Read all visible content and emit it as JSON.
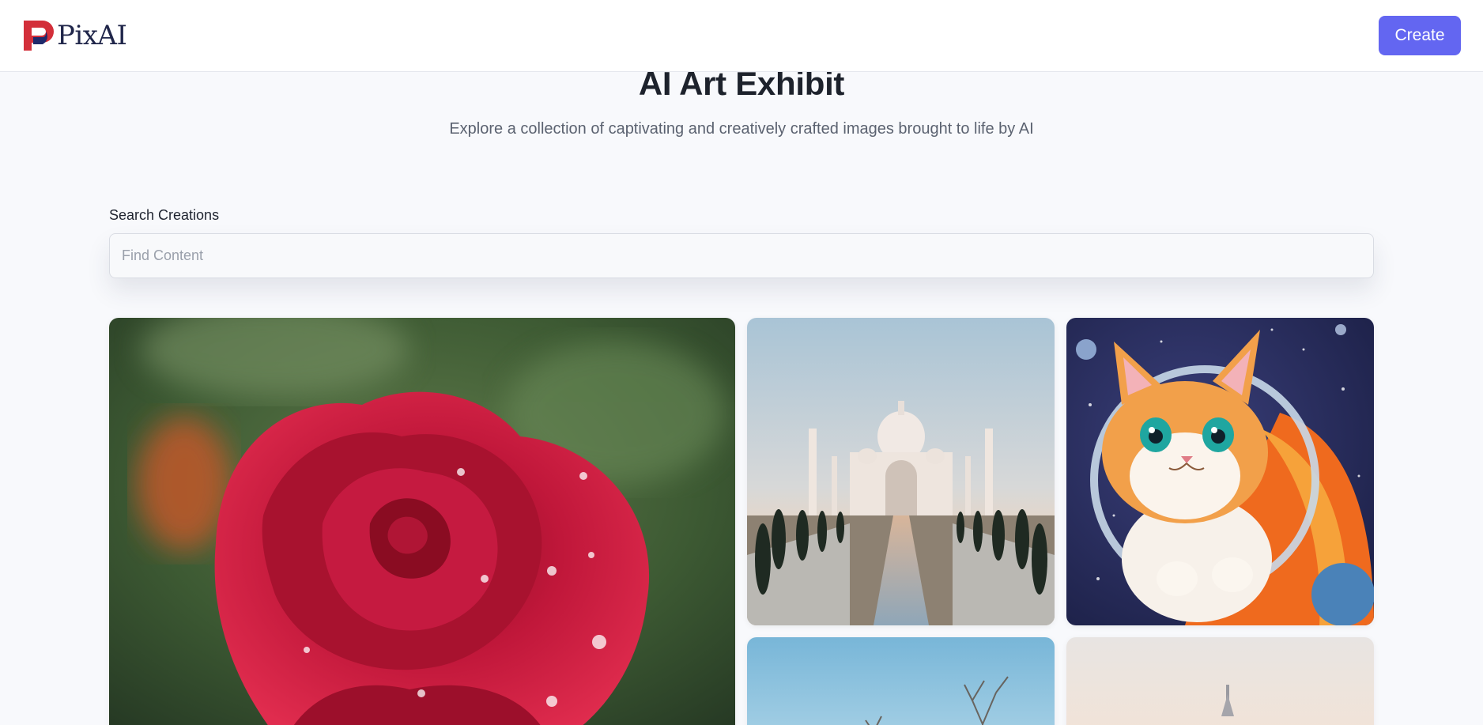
{
  "header": {
    "logo_text": "PixAI",
    "create_label": "Create"
  },
  "hero": {
    "title": "AI Art Exhibit",
    "subtitle": "Explore a collection of captivating and creatively crafted images brought to life by AI"
  },
  "search": {
    "label": "Search Creations",
    "placeholder": "Find Content",
    "value": ""
  },
  "gallery": {
    "items": [
      {
        "subject": "red rose with water droplets"
      },
      {
        "subject": "Taj Mahal at sunrise"
      },
      {
        "subject": "kitten astronaut in space"
      },
      {
        "subject": "bare tree against blue sky"
      },
      {
        "subject": "domed building in haze"
      }
    ]
  },
  "colors": {
    "accent": "#6366f1",
    "logo_red": "#d32f3a",
    "logo_navy": "#1f2a6b",
    "background": "#f8f9fc"
  }
}
